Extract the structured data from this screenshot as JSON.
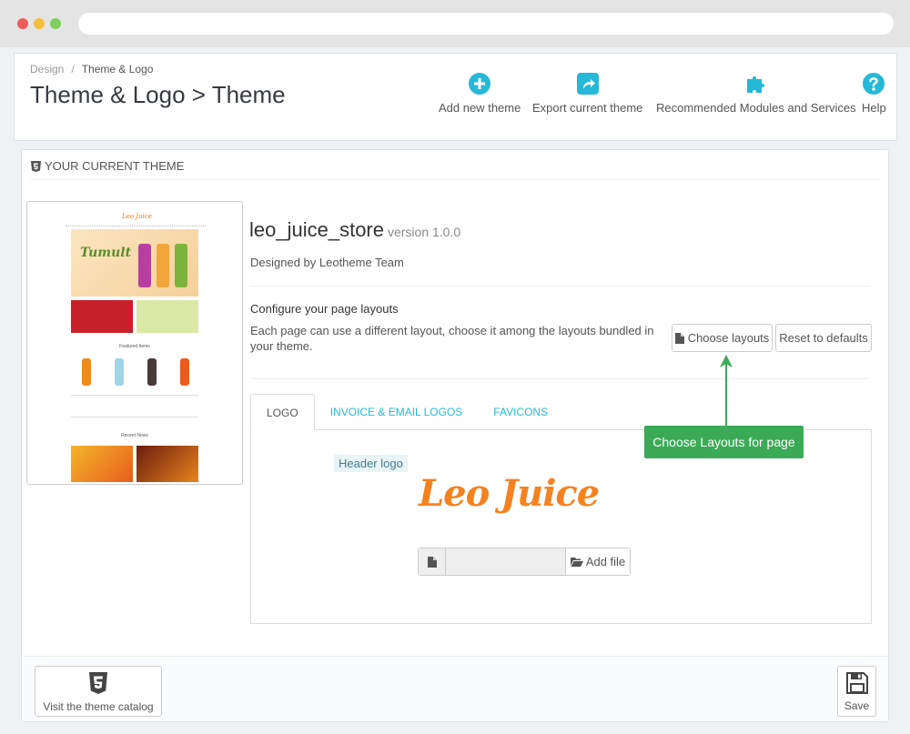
{
  "breadcrumb": {
    "parent": "Design",
    "separator": "/",
    "current": "Theme & Logo"
  },
  "page_title": "Theme & Logo > Theme",
  "toolbar": {
    "add_new_theme": "Add new theme",
    "export_current_theme": "Export current theme",
    "recommended": "Recommended Modules and Services",
    "help": "Help"
  },
  "panel": {
    "heading": "YOUR CURRENT THEME"
  },
  "theme": {
    "name": "leo_juice_store",
    "version": "version 1.0.0",
    "designed_by": "Designed by Leotheme Team",
    "preview": {
      "logo": "Leo Juice",
      "hero_text": "Tumult",
      "featured_title": "Featured Items",
      "news_title": "Recent News"
    }
  },
  "layouts": {
    "title": "Configure your page layouts",
    "description": "Each page can use a different layout, choose it among the layouts bundled in your theme.",
    "choose_button": "Choose layouts",
    "reset_button": "Reset to defaults"
  },
  "tabs": [
    {
      "label": "LOGO",
      "active": true
    },
    {
      "label": "INVOICE & EMAIL LOGOS",
      "active": false
    },
    {
      "label": "FAVICONS",
      "active": false
    }
  ],
  "logo_tab": {
    "header_logo_label": "Header logo",
    "logo_text": "Leo Juice",
    "add_file": "Add file"
  },
  "annotation": {
    "text": "Choose Layouts for page"
  },
  "footer": {
    "catalog_button": "Visit the theme catalog",
    "save_button": "Save"
  },
  "colors": {
    "accent": "#25b9d7",
    "logo_orange": "#f5821f",
    "callout_green": "#3aaa56"
  },
  "icons": {
    "add_new_theme": "plus-circle-icon",
    "export": "export-share-icon",
    "recommended": "puzzle-icon",
    "help": "question-circle-icon",
    "heading": "html5-icon",
    "choose_layouts": "file-icon",
    "add_file": "folder-open-icon",
    "catalog": "html5-icon",
    "save": "floppy-disk-icon"
  }
}
